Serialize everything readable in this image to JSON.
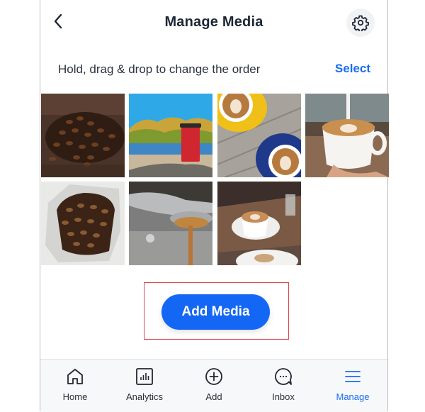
{
  "header": {
    "title": "Manage Media",
    "back_icon": "chevron-left-icon",
    "settings_icon": "gear-icon"
  },
  "instructions": {
    "hint": "Hold, drag & drop to change the order",
    "select_label": "Select"
  },
  "media": [
    {
      "description": "Roasted coffee beans on wooden table"
    },
    {
      "description": "Red 'Thank you' coffee cup by a lake with autumn trees"
    },
    {
      "description": "Two latte art cups on yellow and blue saucers"
    },
    {
      "description": "Hand holding latte with milk being poured"
    },
    {
      "description": "Open bag of coffee beans"
    },
    {
      "description": "Espresso pouring from portafilter"
    },
    {
      "description": "Latte art cup on table with glass and pastry"
    }
  ],
  "add_media": {
    "label": "Add Media",
    "accent": "#1467f5",
    "highlight_border": "#e0444a"
  },
  "tabbar": {
    "active_color": "#1a6df0",
    "items": [
      {
        "label": "Home",
        "icon": "home-icon",
        "active": false
      },
      {
        "label": "Analytics",
        "icon": "analytics-icon",
        "active": false
      },
      {
        "label": "Add",
        "icon": "plus-circle-icon",
        "active": false
      },
      {
        "label": "Inbox",
        "icon": "chat-bubble-icon",
        "active": false
      },
      {
        "label": "Manage",
        "icon": "menu-icon",
        "active": true
      }
    ]
  }
}
